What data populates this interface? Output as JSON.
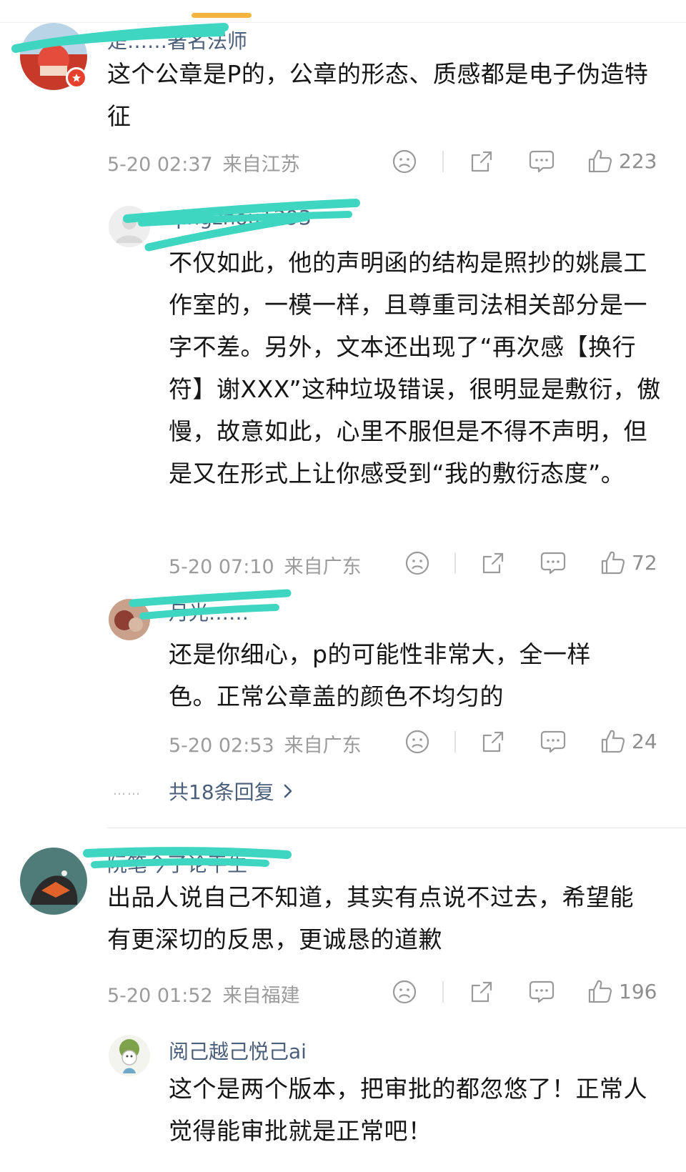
{
  "comments": [
    {
      "author": "是……著名法师",
      "text": "这个公章是P的，公章的形态、质感都是电子伪造特征",
      "time": "5-20 02:37",
      "location": "来自江苏",
      "likes": "223"
    },
    {
      "author": "阮笔今了论平生",
      "text": "出品人说自己不知道，其实有点说不过去，希望能有更深切的反思，更诚恳的道歉",
      "time": "5-20 01:52",
      "location": "来自福建",
      "likes": "196"
    }
  ],
  "replies": [
    {
      "author": "qingzhou1393",
      "text": "不仅如此，他的声明函的结构是照抄的姚晨工作室的，一模一样，且尊重司法相关部分是一字不差。另外，文本还出现了“再次感【换行符】谢XXX”这种垃圾错误，很明显是敷衍，傲慢，故意如此，心里不服但是不得不声明，但是又在形式上让你感受到“我的敷衍态度”。",
      "time": "5-20 07:10",
      "location": "来自广东",
      "likes": "72"
    },
    {
      "author": "月光……",
      "text": "还是你细心，p的可能性非常大，全一样色。正常公章盖的颜色不均匀的",
      "time": "5-20 02:53",
      "location": "来自广东",
      "likes": "24"
    },
    {
      "author": "阅己越己悦己ai",
      "text": "这个是两个版本，把审批的都忽悠了！正常人觉得能审批就是正常吧！"
    }
  ],
  "more_replies": {
    "dots": "……",
    "label": "共18条回复"
  },
  "colors": {
    "accent_tab": "#f3b53f",
    "name": "#4b5e7a",
    "meta": "#9b9b9b",
    "scribble": "#3fd6c1"
  },
  "icons": [
    "dislike-icon",
    "share-icon",
    "comment-icon",
    "like-icon",
    "chevron-right-icon",
    "verified-badge-icon"
  ]
}
